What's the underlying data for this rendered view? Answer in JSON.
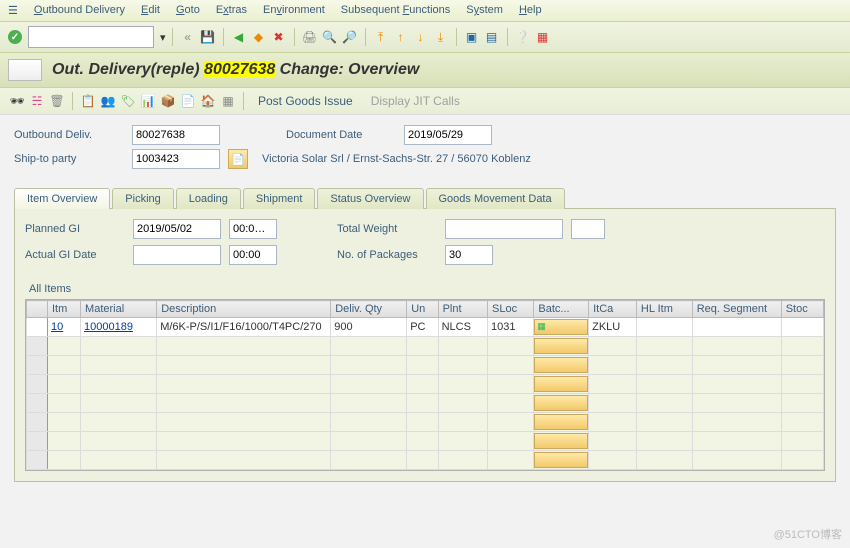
{
  "menu": {
    "outbound": "Outbound Delivery",
    "edit": "Edit",
    "goto": "Goto",
    "extras": "Extras",
    "env": "Environment",
    "subfn": "Subsequent Functions",
    "system": "System",
    "help": "Help"
  },
  "title": {
    "pre": "Out. Delivery(reple) ",
    "doc": "80027638",
    "post": " Change: Overview"
  },
  "apptb": {
    "pgi": "Post Goods Issue",
    "jit": "Display JIT Calls"
  },
  "hdr": {
    "outdeliv_lbl": "Outbound Deliv.",
    "outdeliv": "80027638",
    "docdate_lbl": "Document Date",
    "docdate": "2019/05/29",
    "shipto_lbl": "Ship-to party",
    "shipto": "1003423",
    "shipto_desc": "Victoria Solar Srl / Ernst-Sachs-Str. 27 / 56070 Koblenz"
  },
  "tabs": {
    "t1": "Item Overview",
    "t2": "Picking",
    "t3": "Loading",
    "t4": "Shipment",
    "t5": "Status Overview",
    "t6": "Goods Movement Data"
  },
  "panel": {
    "planned_lbl": "Planned GI",
    "planned": "2019/05/02",
    "planned_t": "00:0…",
    "actual_lbl": "Actual GI Date",
    "actual": "",
    "actual_t": "00:00",
    "tw_lbl": "Total Weight",
    "tw": "",
    "pkg_lbl": "No. of Packages",
    "pkg": "30",
    "allitems": "All Items"
  },
  "cols": {
    "itm": "Itm",
    "mat": "Material",
    "desc": "Description",
    "qty": "Deliv. Qty",
    "un": "Un",
    "plnt": "Plnt",
    "sloc": "SLoc",
    "batc": "Batc...",
    "itca": "ItCa",
    "hl": "HL Itm",
    "req": "Req. Segment",
    "stoc": "Stoc"
  },
  "row": {
    "itm": "10",
    "mat": "10000189",
    "desc": "M/6K-P/S/I1/F16/1000/T4PC/270",
    "qty": "900",
    "un": "PC",
    "plnt": "NLCS",
    "sloc": "1031",
    "itca": "ZKLU"
  },
  "watermark": "@51CTO博客"
}
